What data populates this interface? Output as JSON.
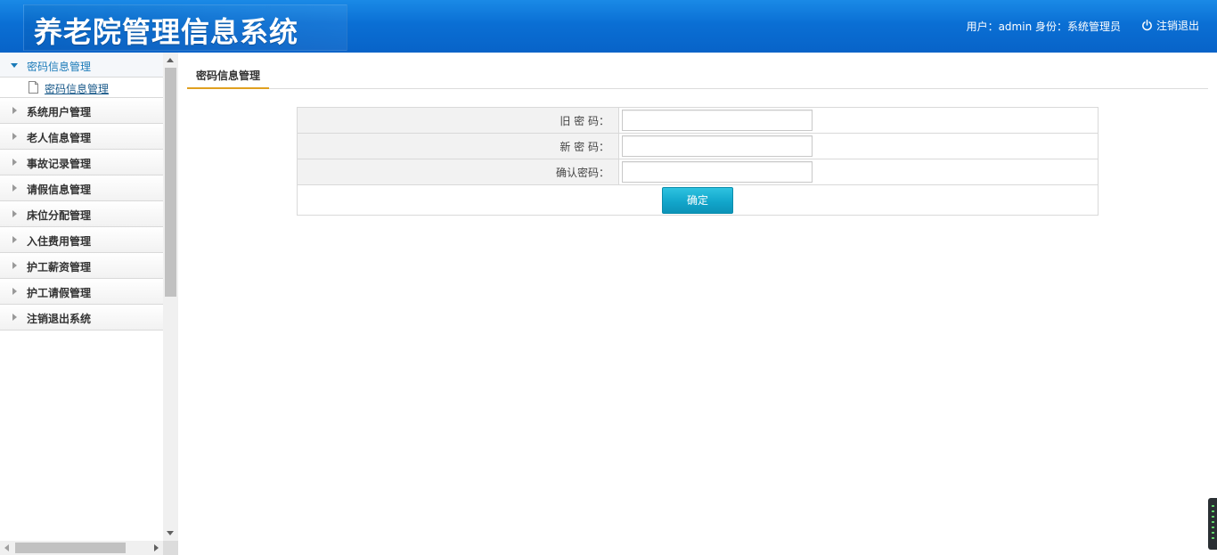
{
  "header": {
    "title": "养老院管理信息系统",
    "user_info": "用户：admin 身份：系统管理员",
    "logout_label": "注销退出"
  },
  "sidebar": {
    "items": [
      {
        "label": "密码信息管理",
        "open": true,
        "children": [
          {
            "label": "密码信息管理"
          }
        ]
      },
      {
        "label": "系统用户管理"
      },
      {
        "label": "老人信息管理"
      },
      {
        "label": "事故记录管理"
      },
      {
        "label": "请假信息管理"
      },
      {
        "label": "床位分配管理"
      },
      {
        "label": "入住费用管理"
      },
      {
        "label": "护工薪资管理"
      },
      {
        "label": "护工请假管理"
      },
      {
        "label": "注销退出系统"
      }
    ]
  },
  "main": {
    "tab_label": "密码信息管理",
    "form": {
      "old_password_label": "旧 密 码：",
      "new_password_label": "新 密 码：",
      "confirm_password_label": "确认密码：",
      "old_password_value": "",
      "new_password_value": "",
      "confirm_password_value": "",
      "submit_label": "确定"
    }
  },
  "colors": {
    "header_blue": "#0a6fd4",
    "active_menu": "#1a7ab8",
    "button": "#12a6cb",
    "tab_underline": "#e0a020"
  }
}
